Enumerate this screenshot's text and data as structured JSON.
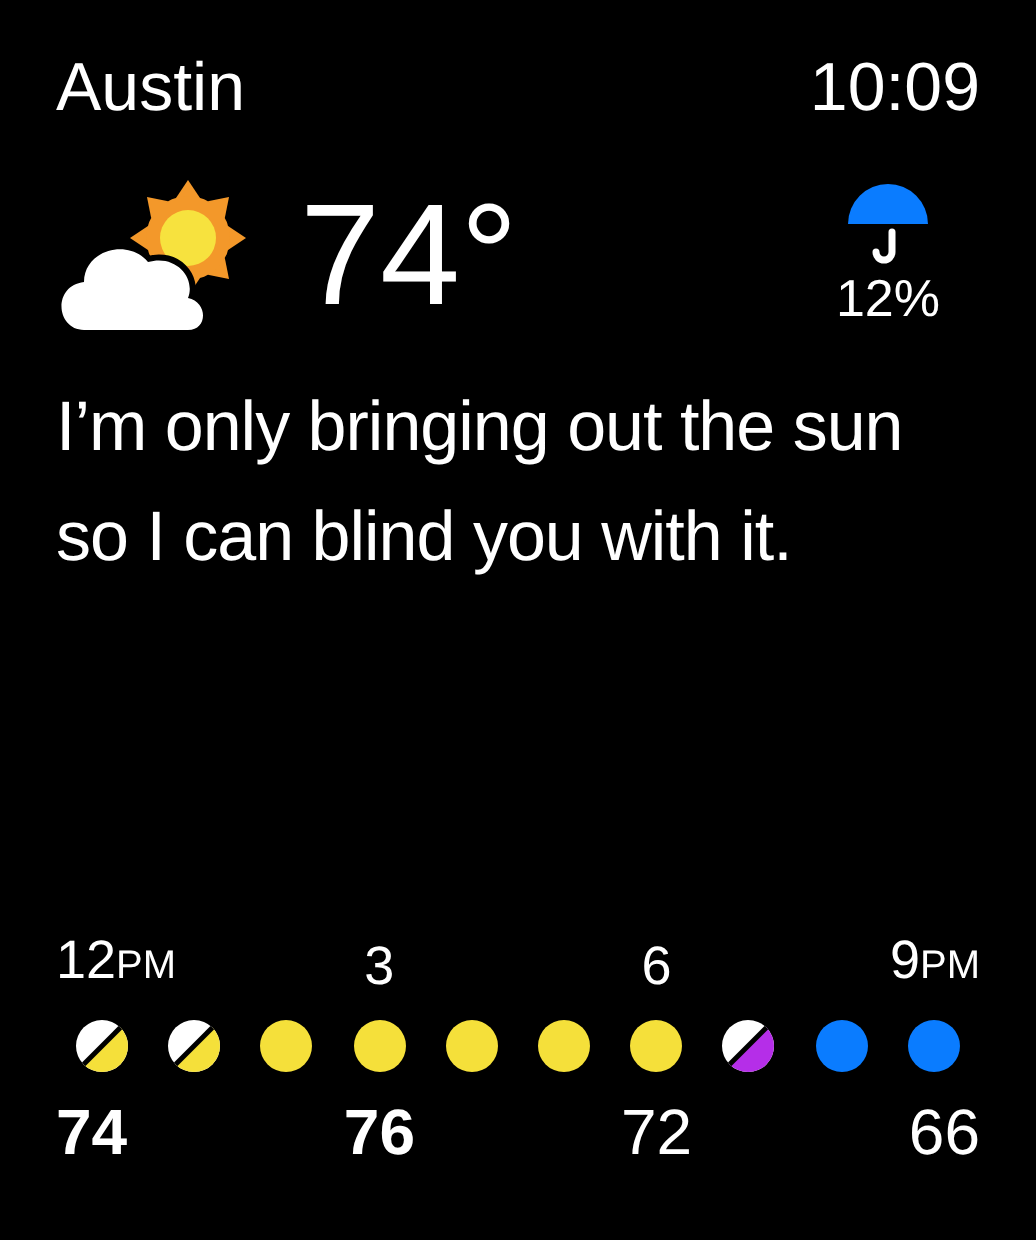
{
  "city": "Austin",
  "time": "10:09",
  "current": {
    "temperature": "74°",
    "precipitation": "12%"
  },
  "quote": "I’m only bringing out the sun so I can blind you with it.",
  "hours": [
    {
      "kind": "split",
      "color": "#f5e03a",
      "time": "12",
      "suffix": "PM",
      "temp": "74",
      "bold": true
    },
    {
      "kind": "split",
      "color": "#f5e03a"
    },
    {
      "kind": "solid",
      "color": "#f5e03a"
    },
    {
      "kind": "solid",
      "color": "#f5e03a",
      "time": "3",
      "temp": "76",
      "bold": true
    },
    {
      "kind": "solid",
      "color": "#f5e03a"
    },
    {
      "kind": "solid",
      "color": "#f5e03a"
    },
    {
      "kind": "solid",
      "color": "#f5e03a",
      "time": "6",
      "temp": "72",
      "bold": false
    },
    {
      "kind": "split",
      "color": "#b52ee8"
    },
    {
      "kind": "solid",
      "color": "#0a7cff"
    },
    {
      "kind": "solid",
      "color": "#0a7cff",
      "time": "9",
      "suffix": "PM",
      "temp": "66",
      "bold": false
    }
  ]
}
